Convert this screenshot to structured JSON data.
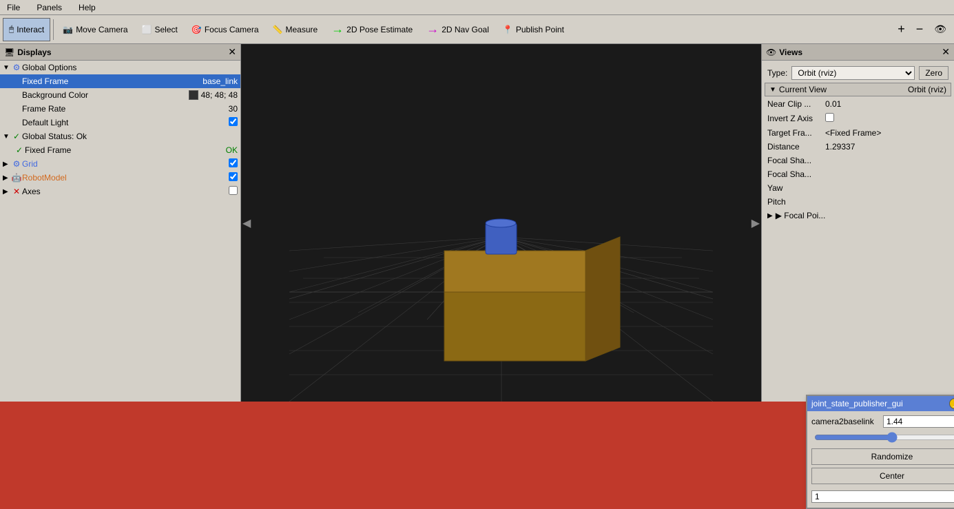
{
  "menubar": {
    "items": [
      "File",
      "Panels",
      "Help"
    ]
  },
  "toolbar": {
    "buttons": [
      {
        "id": "interact",
        "label": "Interact",
        "icon": "🖱",
        "active": true
      },
      {
        "id": "move-camera",
        "label": "Move Camera",
        "icon": "📷",
        "active": false
      },
      {
        "id": "select",
        "label": "Select",
        "icon": "⬜",
        "active": false
      },
      {
        "id": "focus-camera",
        "label": "Focus Camera",
        "icon": "🎯",
        "active": false
      },
      {
        "id": "measure",
        "label": "Measure",
        "icon": "📏",
        "active": false
      },
      {
        "id": "2d-pose",
        "label": "2D Pose Estimate",
        "icon": "→",
        "active": false
      },
      {
        "id": "2d-nav",
        "label": "2D Nav Goal",
        "icon": "→",
        "active": false
      },
      {
        "id": "publish-point",
        "label": "Publish Point",
        "icon": "📍",
        "active": false
      }
    ],
    "extra_icons": [
      "+",
      "−",
      "👁"
    ]
  },
  "displays_panel": {
    "title": "Displays",
    "items": [
      {
        "indent": 0,
        "expand": "▼",
        "icon": "⚙",
        "label": "Global Options",
        "value": "",
        "type": "header",
        "icon_color": "blue"
      },
      {
        "indent": 1,
        "expand": "",
        "icon": "",
        "label": "Fixed Frame",
        "value": "base_link",
        "type": "selected"
      },
      {
        "indent": 1,
        "expand": "",
        "icon": "",
        "label": "Background Color",
        "value": "48; 48; 48",
        "type": "color"
      },
      {
        "indent": 1,
        "expand": "",
        "icon": "",
        "label": "Frame Rate",
        "value": "30",
        "type": "value"
      },
      {
        "indent": 1,
        "expand": "",
        "icon": "",
        "label": "Default Light",
        "value": "checked",
        "type": "checkbox"
      },
      {
        "indent": 0,
        "expand": "▼",
        "icon": "✓",
        "label": "Global Status: Ok",
        "value": "",
        "type": "status",
        "icon_color": "green"
      },
      {
        "indent": 1,
        "expand": "",
        "icon": "✓",
        "label": "Fixed Frame",
        "value": "OK",
        "type": "ok",
        "icon_color": "green"
      },
      {
        "indent": 0,
        "expand": "▶",
        "icon": "⚙",
        "label": "Grid",
        "value": "checked",
        "type": "checkbox-item",
        "icon_color": "blue"
      },
      {
        "indent": 0,
        "expand": "▶",
        "icon": "🤖",
        "label": "RobotModel",
        "value": "checked",
        "type": "checkbox-item",
        "icon_color": "orange"
      },
      {
        "indent": 0,
        "expand": "▶",
        "icon": "✕",
        "label": "Axes",
        "value": "unchecked",
        "type": "checkbox-item",
        "icon_color": "red"
      }
    ]
  },
  "views_panel": {
    "title": "Views",
    "type_label": "Type:",
    "type_value": "Orbit (rviz)",
    "zero_button": "Zero",
    "current_view_label": "Current View",
    "current_view_value": "Orbit (rviz)",
    "view_fields": [
      {
        "label": "Near Clip ...",
        "value": "0.01"
      },
      {
        "label": "Invert Z Axis",
        "value": "checkbox"
      },
      {
        "label": "Target Fra...",
        "value": "<Fixed Frame>"
      },
      {
        "label": "Distance",
        "value": "1.29337"
      },
      {
        "label": "Focal Sha...",
        "value": ""
      },
      {
        "label": "Focal Sha...",
        "value": ""
      },
      {
        "label": "Yaw",
        "value": ""
      },
      {
        "label": "Pitch",
        "value": ""
      },
      {
        "label": "▶ Focal Poi...",
        "value": ""
      }
    ]
  },
  "popup": {
    "title": "joint_state_publisher_gui",
    "field_label": "camera2baselink",
    "field_value": "1.44",
    "slider_value": 50,
    "buttons": [
      "Randomize",
      "Center"
    ],
    "number_value": "1"
  }
}
